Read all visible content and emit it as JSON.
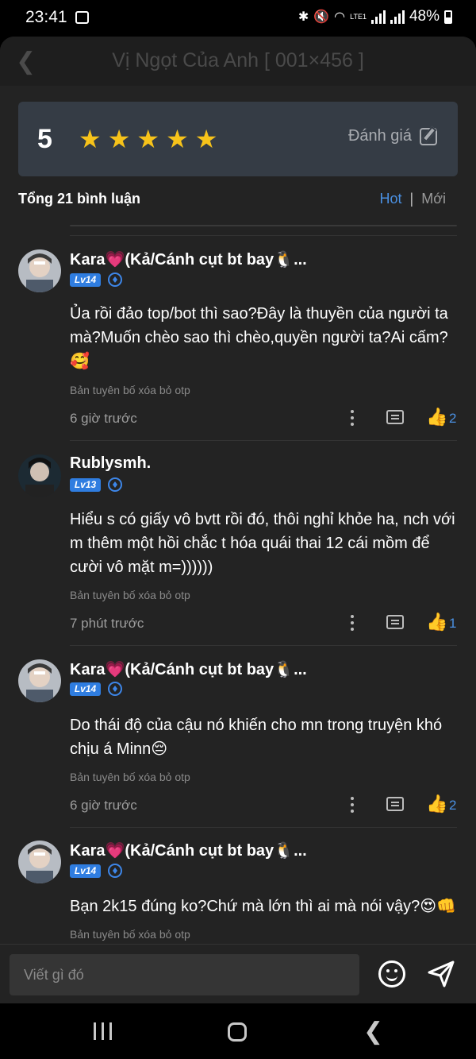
{
  "status_bar": {
    "time": "23:41",
    "battery": "48%",
    "network": "LTE1"
  },
  "header": {
    "title": "Vị Ngọt Của Anh [ 001×456 ]"
  },
  "rating": {
    "score": "5",
    "stars": 5,
    "rate_label": "Đánh giá",
    "star_color": "#f7c31a"
  },
  "comments_header": {
    "count_label": "Tổng 21 bình luận",
    "tab_hot": "Hot",
    "tab_separator": "|",
    "tab_new": "Mới",
    "accent": "#4a90e2"
  },
  "comments": [
    {
      "username": "Kara💗(Kả/Cánh cụt bt bay🐧...",
      "level": "Lv14",
      "text": "Ủa rồi đảo top/bot thì sao?Đây là thuyền của người ta mà?Muốn chèo sao thì chèo,quyền người ta?Ai cấm?🥰",
      "signature": "Bản tuyên bố xóa bỏ otp",
      "time": "6 giờ trước",
      "likes": "2"
    },
    {
      "username": "Rublysmh.",
      "level": "Lv13",
      "text": "Hiểu s có giấy vô bvtt rồi đó, thôi nghỉ khỏe ha, nch với m thêm một hồi chắc t hóa quái thai 12 cái mồm để cười vô mặt m=))))))",
      "signature": "Bản tuyên bố xóa bỏ otp",
      "time": "7 phút trước",
      "likes": "1"
    },
    {
      "username": "Kara💗(Kả/Cánh cụt bt bay🐧...",
      "level": "Lv14",
      "text": "Do thái độ của cậu nó khiến cho mn trong truyện khó chịu á Minn😔",
      "signature": "Bản tuyên bố xóa bỏ otp",
      "time": "6 giờ trước",
      "likes": "2"
    },
    {
      "username": "Kara💗(Kả/Cánh cụt bt bay🐧...",
      "level": "Lv14",
      "text": "Bạn 2k15 đúng ko?Chứ mà lớn thì ai mà nói vậy?😍👊",
      "signature": "Bản tuyên bố xóa bỏ otp"
    }
  ],
  "composer": {
    "placeholder": "Viết gì đó"
  }
}
